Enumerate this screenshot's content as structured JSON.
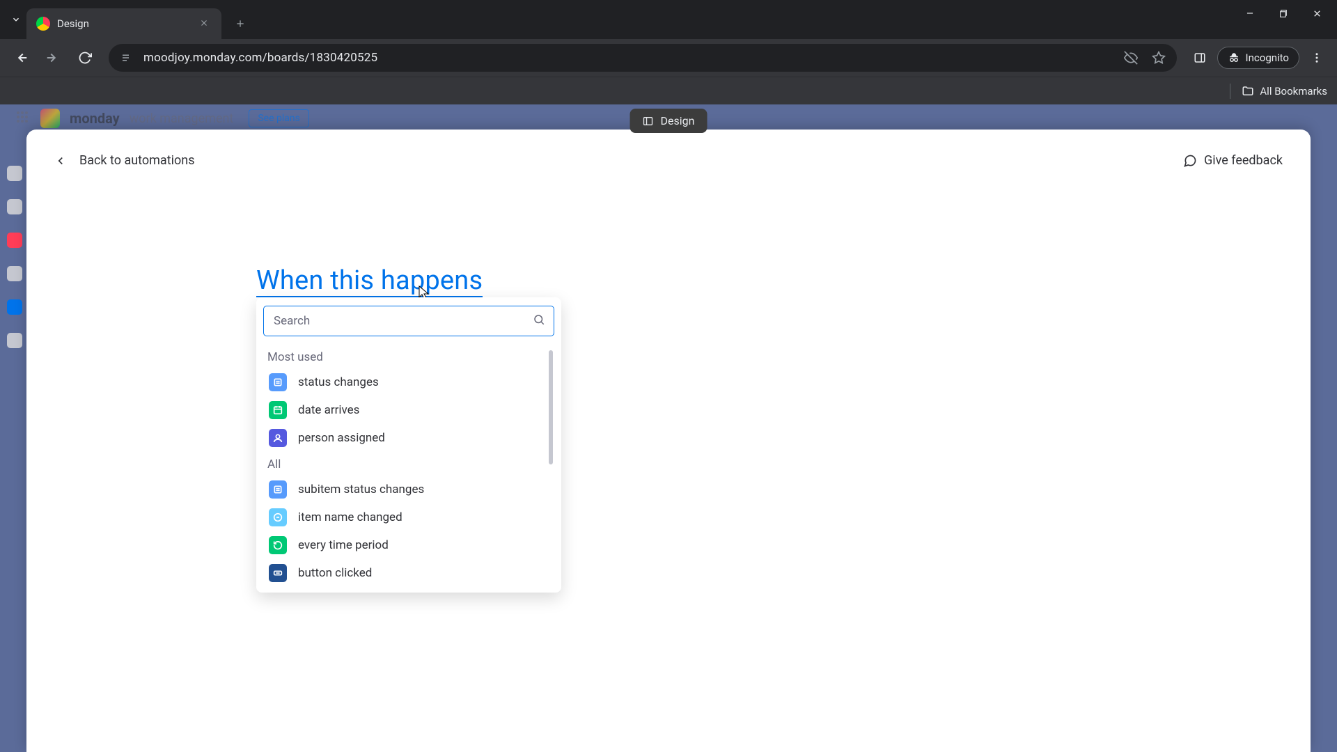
{
  "browser": {
    "tab_title": "Design",
    "url": "moodjoy.monday.com/boards/1830420525",
    "incognito_label": "Incognito",
    "all_bookmarks": "All Bookmarks"
  },
  "page_pill": "Design",
  "monday_header": {
    "brand": "monday",
    "sub": "work management",
    "see_plans": "See plans"
  },
  "modal": {
    "back": "Back to automations",
    "feedback": "Give feedback",
    "trigger_title": "When this happens",
    "search_placeholder": "Search",
    "sections": {
      "most_used_label": "Most used",
      "all_label": "All"
    },
    "most_used": [
      {
        "label": "status changes",
        "icon": "status",
        "color": "c-blue"
      },
      {
        "label": "date arrives",
        "icon": "date",
        "color": "c-green"
      },
      {
        "label": "person assigned",
        "icon": "person",
        "color": "c-indigo"
      }
    ],
    "all": [
      {
        "label": "subitem status changes",
        "icon": "status",
        "color": "c-blue"
      },
      {
        "label": "item name changed",
        "icon": "rename",
        "color": "c-cyan"
      },
      {
        "label": "every time period",
        "icon": "recur",
        "color": "c-green"
      },
      {
        "label": "button clicked",
        "icon": "button",
        "color": "c-darkblue"
      }
    ]
  }
}
